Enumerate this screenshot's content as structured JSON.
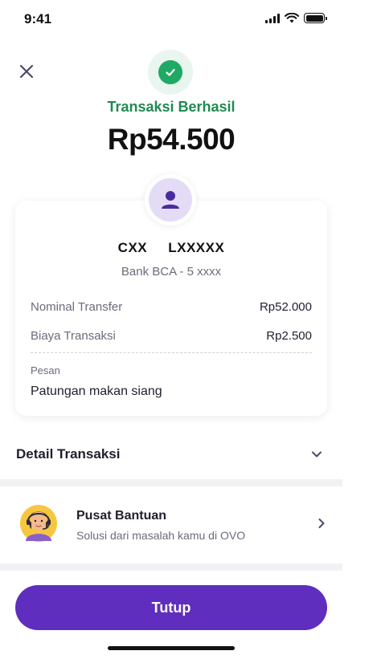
{
  "status_bar": {
    "time": "9:41"
  },
  "header": {
    "status": "Transaksi Berhasil",
    "amount": "Rp54.500",
    "icons": {
      "close": "close-icon",
      "success": "check-icon"
    }
  },
  "recipient": {
    "name": "CXX     LXXXXX",
    "bank": "Bank BCA - 5 xxxx"
  },
  "breakdown": [
    {
      "label": "Nominal Transfer",
      "value": "Rp52.000"
    },
    {
      "label": "Biaya Transaksi",
      "value": "Rp2.500"
    }
  ],
  "note": {
    "label": "Pesan",
    "value": "Patungan makan siang"
  },
  "detail": {
    "title": "Detail Transaksi"
  },
  "help": {
    "title": "Pusat Bantuan",
    "subtitle": "Solusi dari masalah kamu di OVO"
  },
  "actions": {
    "close_label": "Tutup"
  },
  "colors": {
    "success": "#20a964",
    "success_text": "#1f8a52",
    "brand": "#5f2ebe",
    "avatar_bg": "#e4dcf5",
    "avatar_fg": "#4b2a9e"
  }
}
